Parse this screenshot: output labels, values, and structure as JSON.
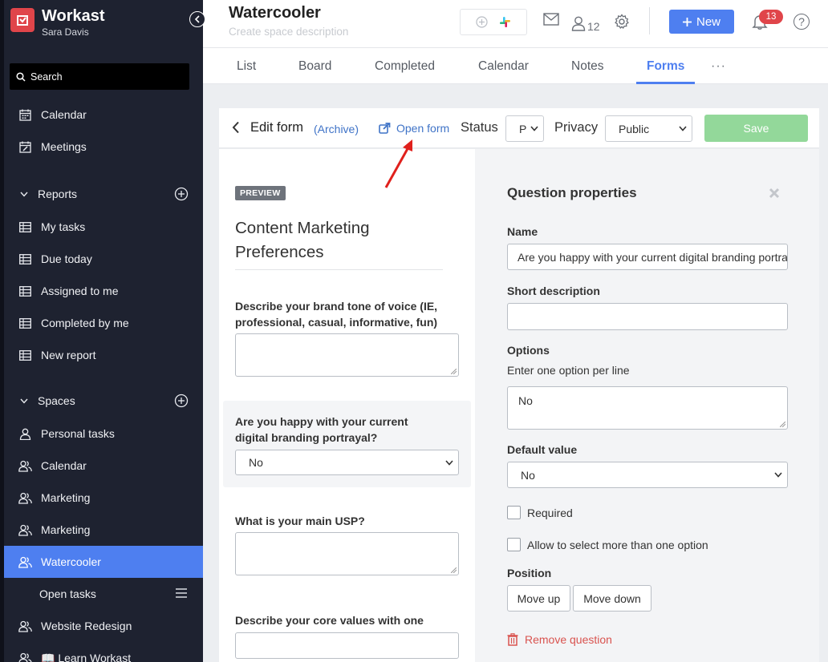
{
  "app": {
    "name": "Workast",
    "user": "Sara Davis"
  },
  "sidebar": {
    "search_label": "Search",
    "top_items": [
      {
        "label": "Calendar",
        "icon": "calendar-icon"
      },
      {
        "label": "Meetings",
        "icon": "calendar-edit-icon"
      }
    ],
    "reports": {
      "label": "Reports",
      "items": [
        {
          "label": "My tasks",
          "icon": "table-icon"
        },
        {
          "label": "Due today",
          "icon": "table-icon"
        },
        {
          "label": "Assigned to me",
          "icon": "table-icon"
        },
        {
          "label": "Completed by me",
          "icon": "table-icon"
        },
        {
          "label": "New report",
          "icon": "table-icon"
        }
      ]
    },
    "spaces": {
      "label": "Spaces",
      "items": [
        {
          "label": "Personal tasks",
          "icon": "user-icon"
        },
        {
          "label": "Calendar",
          "icon": "users-icon"
        },
        {
          "label": "Marketing",
          "icon": "users-icon"
        },
        {
          "label": "Marketing",
          "icon": "users-icon"
        },
        {
          "label": "Watercooler",
          "icon": "users-icon",
          "active": true
        },
        {
          "label": "Open tasks",
          "icon": "menu-icon",
          "sub": true
        },
        {
          "label": "Website Redesign",
          "icon": "users-icon"
        },
        {
          "label": "📖 Learn Workast",
          "icon": "users-icon"
        }
      ]
    }
  },
  "header": {
    "title": "Watercooler",
    "description_placeholder": "Create space description",
    "member_count": "12",
    "new_label": "New",
    "notification_count": "13",
    "help_label": "?"
  },
  "tabs": [
    {
      "label": "List"
    },
    {
      "label": "Board"
    },
    {
      "label": "Completed"
    },
    {
      "label": "Calendar"
    },
    {
      "label": "Notes"
    },
    {
      "label": "Forms",
      "active": true
    }
  ],
  "edit_bar": {
    "title": "Edit form",
    "archive_label": "(Archive)",
    "open_form_label": "Open form",
    "status_label": "Status",
    "status_value": "P",
    "privacy_label": "Privacy",
    "privacy_value": "Public",
    "save_label": "Save"
  },
  "preview": {
    "badge": "PREVIEW",
    "form_title": "Content Marketing Preferences",
    "questions": [
      {
        "label": "Describe your brand tone of voice (IE, professional, casual, informative, fun)",
        "type": "textarea"
      },
      {
        "label": "Are you happy with your current digital branding portrayal?",
        "type": "select",
        "value": "No"
      },
      {
        "label": "What is your main USP?",
        "type": "textarea"
      },
      {
        "label": "Describe your core values with one word.",
        "type": "text"
      }
    ]
  },
  "properties": {
    "title": "Question properties",
    "name_label": "Name",
    "name_value": "Are you happy with your current digital branding portrayal?",
    "short_desc_label": "Short description",
    "short_desc_value": "",
    "options_label": "Options",
    "options_hint": "Enter one option per line",
    "options_value": "No",
    "default_label": "Default value",
    "default_value": "No",
    "required_label": "Required",
    "required_checked": false,
    "multi_label": "Allow to select more than one option",
    "multi_checked": false,
    "position_label": "Position",
    "move_up_label": "Move up",
    "move_down_label": "Move down",
    "remove_label": "Remove question"
  },
  "colors": {
    "sidebar_bg": "#1e2230",
    "accent": "#4e7ff0",
    "brand_red": "#e0454a",
    "save_green": "#93d89a",
    "link": "#3f73c7",
    "danger": "#d9534f"
  }
}
